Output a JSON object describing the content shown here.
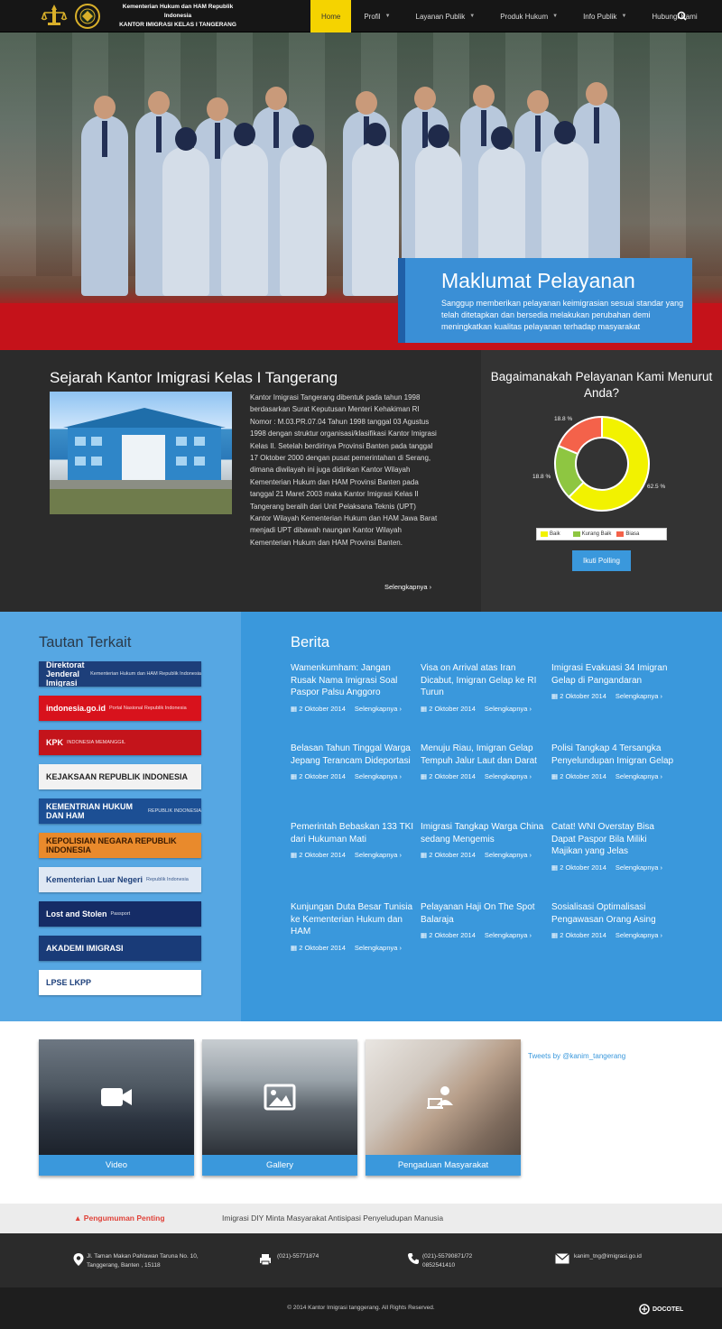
{
  "header": {
    "brand_line1": "Kementerian Hukum dan HAM Republik Indonesia",
    "brand_line2": "KANTOR IMIGRASI KELAS I TANGERANG",
    "logo1_label": "PENGAYOMAN",
    "nav": [
      {
        "label": "Home",
        "active": true
      },
      {
        "label": "Profil",
        "dropdown": true
      },
      {
        "label": "Layanan Publik",
        "dropdown": true
      },
      {
        "label": "Produk Hukum",
        "dropdown": true
      },
      {
        "label": "Info Publik",
        "dropdown": true
      },
      {
        "label": "Hubungi Kami"
      }
    ]
  },
  "hero": {
    "title": "Maklumat Pelayanan",
    "text": "Sanggup memberikan pelayanan keimigrasian sesuai standar yang telah ditetapkan dan bersedia melakukan perubahan demi meningkatkan kualitas pelayanan terhadap masyarakat"
  },
  "sejarah": {
    "title": "Sejarah Kantor Imigrasi Kelas I Tangerang",
    "text": "Kantor Imigrasi Tangerang dibentuk pada tahun 1998 berdasarkan Surat Keputusan Menteri Kehakiman RI Nomor : M.03.PR.07.04 Tahun 1998 tanggal 03 Agustus 1998 dengan struktur organisasi/klasifikasi Kantor Imigrasi Kelas II. Setelah berdirinya Provinsi Banten pada tanggal 17 Oktober 2000 dengan pusat pemerintahan di Serang, dimana diwilayah ini juga didirikan Kantor Wilayah Kementerian Hukum dan HAM Provinsi Banten pada tanggal 21 Maret 2003 maka Kantor Imigrasi Kelas II Tangerang beralih dari Unit Pelaksana Teknis (UPT) Kantor Wilayah Kementerian Hukum dan HAM Jawa Barat menjadi UPT dibawah naungan Kantor Wilayah Kementerian Hukum dan HAM Provinsi Banten.",
    "more": "Selengkapnya ›"
  },
  "poll": {
    "title": "Bagaimanakah Pelayanan Kami Menurut Anda?",
    "button": "Ikuti Polling",
    "slices": [
      {
        "label": "Baik",
        "value": 62.5,
        "text": "62.5 %",
        "color": "#f2f200"
      },
      {
        "label": "Kurang Baik",
        "value": 18.8,
        "text": "18.8 %",
        "color": "#8ec641"
      },
      {
        "label": "Biasa",
        "value": 18.8,
        "text": "18.8 %",
        "color": "#f4624a"
      }
    ]
  },
  "tautan": {
    "title": "Tautan Terkait",
    "links": [
      {
        "label": "Direktorat Jenderal Imigrasi",
        "sub": "Kementerian Hukum dan HAM Republik Indonesia",
        "bg": "#1d3f7a",
        "fg": "#ffffff"
      },
      {
        "label": "indonesia.go.id",
        "sub": "Portal Nasional Republik Indonesia",
        "bg": "#d8121c",
        "fg": "#ffffff"
      },
      {
        "label": "KPK",
        "sub": "INDONESIA MEMANGGIL",
        "bg": "#c4141b",
        "fg": "#ffffff"
      },
      {
        "label": "KEJAKSAAN REPUBLIK INDONESIA",
        "sub": "",
        "bg": "#f2f2f2",
        "fg": "#222222"
      },
      {
        "label": "KEMENTRIAN HUKUM DAN HAM",
        "sub": "REPUBLIK INDONESIA",
        "bg": "#1c4f94",
        "fg": "#ffffff"
      },
      {
        "label": "KEPOLISIAN NEGARA REPUBLIK INDONESIA",
        "sub": "",
        "bg": "#e98a2c",
        "fg": "#3a1a00"
      },
      {
        "label": "Kementerian Luar Negeri",
        "sub": "Republik Indonesia",
        "bg": "#dfe8f4",
        "fg": "#1c3f7a"
      },
      {
        "label": "Lost and Stolen",
        "sub": "Passport",
        "bg": "#152c66",
        "fg": "#ffffff"
      },
      {
        "label": "AKADEMI IMIGRASI",
        "sub": "",
        "bg": "#193b78",
        "fg": "#ffffff"
      },
      {
        "label": "LPSE LKPP",
        "sub": "",
        "bg": "#ffffff",
        "fg": "#1c3f7a"
      }
    ]
  },
  "berita": {
    "title": "Berita",
    "items": [
      {
        "title": "Wamenkumham: Jangan Rusak Nama Imigrasi Soal Paspor Palsu Anggoro",
        "date": "2 Oktober 2014",
        "more": "Selengkapnya ›"
      },
      {
        "title": "Visa on Arrival atas Iran Dicabut, Imigran Gelap ke RI Turun",
        "date": "2 Oktober 2014",
        "more": "Selengkapnya ›"
      },
      {
        "title": "Imigrasi Evakuasi 34 Imigran Gelap di Pangandaran",
        "date": "2 Oktober 2014",
        "more": "Selengkapnya ›"
      },
      {
        "title": "Belasan Tahun Tinggal Warga Jepang Terancam Dideportasi",
        "date": "2 Oktober 2014",
        "more": "Selengkapnya ›"
      },
      {
        "title": "Menuju Riau, Imigran Gelap Tempuh Jalur Laut dan Darat",
        "date": "2 Oktober 2014",
        "more": "Selengkapnya ›"
      },
      {
        "title": "Polisi Tangkap 4 Tersangka Penyelundupan Imigran Gelap",
        "date": "2 Oktober 2014",
        "more": "Selengkapnya ›"
      },
      {
        "title": "Pemerintah Bebaskan 133 TKI dari Hukuman Mati",
        "date": "2 Oktober 2014",
        "more": "Selengkapnya ›"
      },
      {
        "title": "Imigrasi Tangkap Warga China sedang Mengemis",
        "date": "2 Oktober 2014",
        "more": "Selengkapnya ›"
      },
      {
        "title": "Catat! WNI Overstay Bisa Dapat Paspor Bila Miliki Majikan yang Jelas",
        "date": "2 Oktober 2014",
        "more": "Selengkapnya ›"
      },
      {
        "title": "Kunjungan Duta Besar Tunisia ke Kementerian Hukum dan HAM",
        "date": "2 Oktober 2014",
        "more": "Selengkapnya ›"
      },
      {
        "title": "Pelayanan Haji On The Spot Balaraja",
        "date": "2 Oktober 2014",
        "more": "Selengkapnya ›"
      },
      {
        "title": "Sosialisasi Optimalisasi Pengawasan Orang Asing",
        "date": "2 Oktober 2014",
        "more": "Selengkapnya ›"
      }
    ]
  },
  "media": [
    {
      "label": "Video",
      "icon": "video-camera-icon"
    },
    {
      "label": "Gallery",
      "icon": "image-icon"
    },
    {
      "label": "Pengaduan Masyarakat",
      "icon": "laptop-user-icon"
    }
  ],
  "tweets": "Tweets by @kanim_tangerang",
  "pengumuman": {
    "label": "Pengumuman Penting",
    "text": "Imigrasi DIY Minta Masyarakat Antisipasi Penyeludupan Manusia"
  },
  "contact": {
    "address_line1": "Jl. Taman Makan Pahlawan Taruna No. 10,",
    "address_line2": "Tanggerang, Banten , 15118",
    "fax": "(021)-55771874",
    "phone_line1": "(021)-55790871/72",
    "phone_line2": "0852541410",
    "email": "kanim_tng@imigrasi.go.id"
  },
  "footer": {
    "copyright": "© 2014 Kantor Imigrasi tanggerang. All Rights Reserved.",
    "credit": "DOCOTEL"
  }
}
